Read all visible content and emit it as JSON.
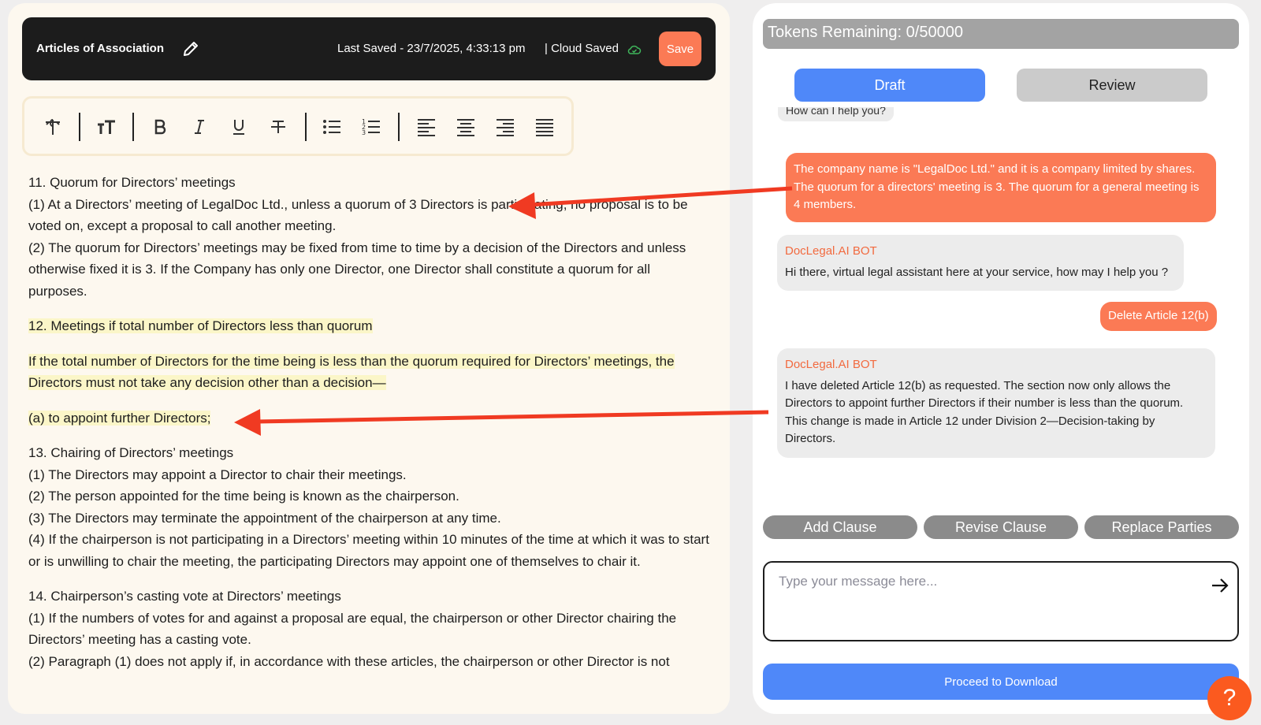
{
  "editor": {
    "title": "Articles of Association",
    "last_saved": "Last Saved - 23/7/2025, 4:33:13 pm",
    "cloud_status": "| Cloud Saved",
    "save_label": "Save",
    "paragraphs": [
      "11. Quorum for Directors’ meetings",
      "(1) At a Directors’ meeting of LegalDoc Ltd., unless a quorum of 3 Directors is participating, no proposal is to be voted on, except a proposal to call another meeting.",
      "(2) The quorum for Directors’ meetings may be fixed from time to time by a decision of the Directors and unless otherwise fixed it is 3. If the Company has only one Director, one Director shall constitute a quorum for all purposes.",
      "12. Meetings if total number of Directors less than quorum",
      "If the total number of Directors for the time being is less than the quorum required for Directors’ meetings, the Directors must not take any decision other than a decision—",
      "(a) to appoint further Directors;",
      "13. Chairing of Directors’ meetings",
      "(1) The Directors may appoint a Director to chair their meetings.",
      "(2) The person appointed for the time being is known as the chairperson.",
      "(3) The Directors may terminate the appointment of the chairperson at any time.",
      "(4) If the chairperson is not participating in a Directors’ meeting within 10 minutes of the time at which it was to start or is unwilling to chair the meeting, the participating Directors may appoint one of themselves to chair it.",
      "14. Chairperson’s casting vote at Directors’ meetings",
      "(1) If the numbers of votes for and against a proposal are equal, the chairperson or other Director chairing the Directors’ meeting has a casting vote.",
      "(2) Paragraph (1) does not apply if, in accordance with these articles, the chairperson or other Director is not"
    ]
  },
  "toolbar": {
    "icons": [
      "paragraph-icon",
      "text-size-icon",
      "bold-icon",
      "italic-icon",
      "underline-icon",
      "strikethrough-icon",
      "bullet-list-icon",
      "numbered-list-icon",
      "align-left-icon",
      "align-center-icon",
      "align-right-icon",
      "align-justify-icon"
    ]
  },
  "chat": {
    "tokens": "Tokens Remaining: 0/50000",
    "tab_draft": "Draft",
    "tab_review": "Review",
    "partial_message": "How can I help you?",
    "messages": [
      {
        "role": "user",
        "text": "The company name is \"LegalDoc Ltd.\" and it is a company limited by shares. The quorum for a directors' meeting is 3. The quorum for a general meeting is 4 members."
      },
      {
        "role": "bot",
        "name": "DocLegal.AI BOT",
        "text": "Hi there, virtual legal assistant here at your service, how may I help you ?"
      },
      {
        "role": "user",
        "text": "Delete Article 12(b)"
      },
      {
        "role": "bot",
        "name": "DocLegal.AI BOT",
        "text": "I have deleted Article 12(b) as requested. The section now only allows the Directors to appoint further Directors if their number is less than the quorum. This change is made in Article 12 under Division 2—Decision-taking by Directors."
      }
    ],
    "quick_actions": [
      "Add Clause",
      "Revise Clause",
      "Replace Parties"
    ],
    "input_placeholder": "Type your message here...",
    "download_label": "Proceed to Download"
  },
  "help": {
    "label": "?"
  },
  "colors": {
    "accent_orange": "#fb7a55",
    "primary_blue": "#4f88f9",
    "highlight": "#fbf6c8",
    "arrow_red": "#f03a22"
  }
}
